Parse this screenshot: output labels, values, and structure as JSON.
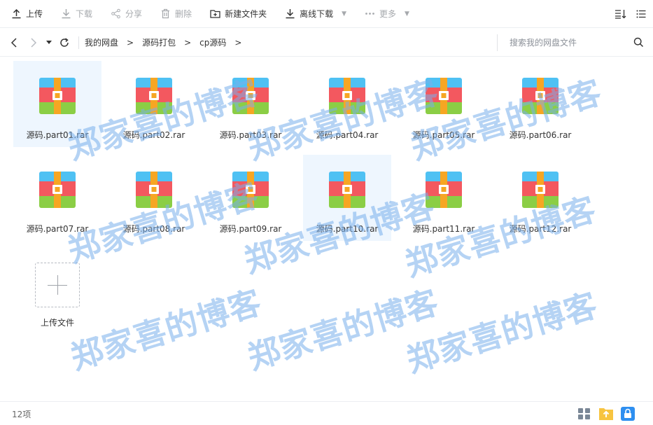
{
  "toolbar": {
    "upload": "上传",
    "download": "下载",
    "share": "分享",
    "delete": "删除",
    "new_folder": "新建文件夹",
    "offline_download": "离线下载",
    "more": "更多"
  },
  "address": {
    "crumbs": [
      "我的网盘",
      "源码打包",
      "cp源码"
    ],
    "search_placeholder": "搜索我的网盘文件"
  },
  "files": [
    {
      "name": "源码.part01.rar",
      "selected": true
    },
    {
      "name": "源码.part02.rar",
      "selected": false
    },
    {
      "name": "源码.part03.rar",
      "selected": false
    },
    {
      "name": "源码.part04.rar",
      "selected": false
    },
    {
      "name": "源码.part05.rar",
      "selected": false
    },
    {
      "name": "源码.part06.rar",
      "selected": false
    },
    {
      "name": "源码.part07.rar",
      "selected": false
    },
    {
      "name": "源码.part08.rar",
      "selected": false
    },
    {
      "name": "源码.part09.rar",
      "selected": false
    },
    {
      "name": "源码.part10.rar",
      "selected": true
    },
    {
      "name": "源码.part11.rar",
      "selected": false
    },
    {
      "name": "源码.part12.rar",
      "selected": false
    }
  ],
  "upload_tile_label": "上传文件",
  "status": {
    "count": "12项"
  },
  "watermark": "郑家喜的博客",
  "colors": {
    "archive_top": "#4fc1f3",
    "archive_middle": "#f3585f",
    "archive_bottom": "#8bce45",
    "archive_strap": "#f6a623",
    "selection": "#eef6fe",
    "watermark": "#78afeb"
  }
}
